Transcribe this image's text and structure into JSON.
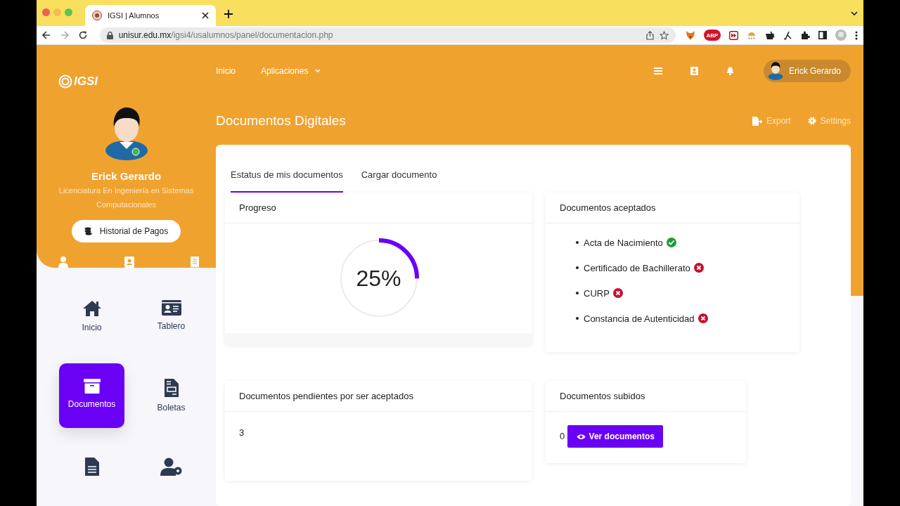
{
  "browser": {
    "tab_title": "IGSI | Alumnos",
    "url_host": "unisur.edu.mx",
    "url_path": "/igsi4/usalumnos/panel/documentacion.php",
    "extension_label": "ABP"
  },
  "header": {
    "logo": "IGSI",
    "nav": [
      {
        "label": "Inicio",
        "dropdown": false
      },
      {
        "label": "Aplicaciones",
        "dropdown": true
      }
    ],
    "user": "Erick Gerardo"
  },
  "profile": {
    "name": "Erick Gerardo",
    "program": "Licenciatura En Ingeniería en Sistemas Computacionales",
    "button": "Historial de Pagos"
  },
  "sidebar": {
    "items": [
      {
        "label": "Inicio",
        "selected": false
      },
      {
        "label": "Tablero",
        "selected": false
      },
      {
        "label": "Documentos",
        "selected": true
      },
      {
        "label": "Boletas",
        "selected": false
      },
      {
        "selected": false
      },
      {
        "selected": false
      }
    ]
  },
  "page": {
    "title": "Documentos Digitales",
    "actions": [
      "Export",
      "Settings"
    ]
  },
  "tabs": [
    {
      "label": "Estatus de mis documentos",
      "selected": true
    },
    {
      "label": "Cargar documento",
      "selected": false
    }
  ],
  "progress": {
    "title": "Progreso",
    "level": 0.25,
    "reading": "25%"
  },
  "accepted": {
    "title": "Documentos aceptados",
    "items": [
      {
        "label": "Acta de Nacimiento",
        "accepted": true
      },
      {
        "label": "Certificado de Bachillerato",
        "accepted": false
      },
      {
        "label": "CURP",
        "accepted": false
      },
      {
        "label": "Constancia de Autenticidad",
        "accepted": false
      }
    ]
  },
  "pending": {
    "title": "Documentos pendientes por ser aceptados",
    "value": "3"
  },
  "uploaded": {
    "title": "Documentos subidos",
    "value": "0",
    "button": "Ver documentos"
  }
}
